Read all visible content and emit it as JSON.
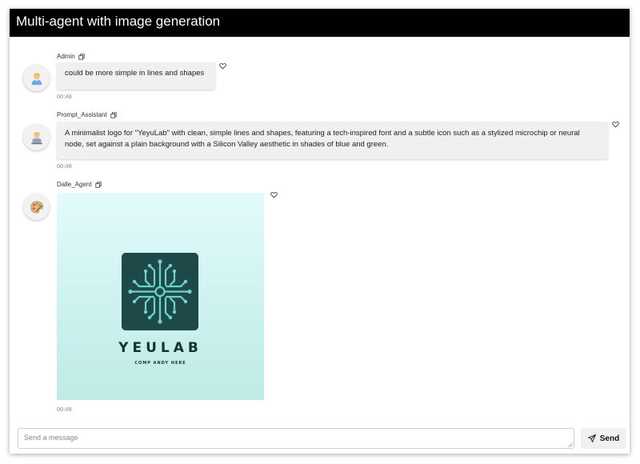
{
  "app": {
    "title": "Multi-agent with image generation"
  },
  "messages": [
    {
      "author": "Admin",
      "avatar_icon": "user-icon",
      "text": "could be more simple in lines and shapes",
      "time": "00:48"
    },
    {
      "author": "Prompt_Assistant",
      "avatar_icon": "technologist-icon",
      "text": "A minimalist logo for \"YeyuLab\" with clean, simple lines and shapes, featuring a tech-inspired font and a subtle icon such as a stylized microchip or neural node, set against a plain background with a Silicon Valley aesthetic in shades of blue and green.",
      "time": "00:48"
    },
    {
      "author": "Dalle_Agent",
      "avatar_icon": "palette-icon",
      "time": "00:48",
      "image": {
        "logo_word": "YEULAB",
        "logo_sub": "COMP ANDY HERE"
      }
    }
  ],
  "composer": {
    "placeholder": "Send a message",
    "send_label": "Send"
  },
  "colors": {
    "header_bg": "#000000",
    "logo_tile": "#1d4a49",
    "logo_lines": "#6fd4c4",
    "bubble_bg": "#f0f0f0"
  }
}
